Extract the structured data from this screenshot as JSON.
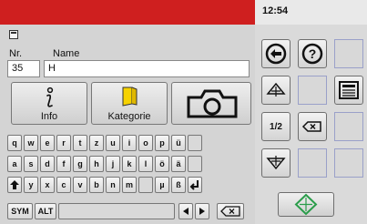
{
  "status": {
    "time": "12:54"
  },
  "form": {
    "nr_label": "Nr.",
    "name_label": "Name",
    "nr_value": "35",
    "name_value": "H"
  },
  "buttons": {
    "info": "Info",
    "kategorie": "Kategorie"
  },
  "keyboard": {
    "row1": [
      "q",
      "w",
      "e",
      "r",
      "t",
      "z",
      "u",
      "i",
      "o",
      "p",
      "ü"
    ],
    "row2": [
      "a",
      "s",
      "d",
      "f",
      "g",
      "h",
      "j",
      "k",
      "l",
      "ö",
      "ä"
    ],
    "row3": [
      "y",
      "x",
      "c",
      "v",
      "b",
      "n",
      "m",
      "µ",
      "ß"
    ],
    "sym": "SYM",
    "alt": "ALT"
  },
  "side": {
    "page": "1/2"
  },
  "icons": [
    "form-icon",
    "info-icon",
    "folder-icon",
    "camera-icon",
    "back-arrow-icon",
    "help-icon",
    "up-icon",
    "save-icon",
    "backspace-icon",
    "down-icon",
    "ok-icon",
    "shift-icon",
    "enter-icon",
    "left-arrow-icon",
    "right-arrow-icon"
  ],
  "colors": {
    "header_red": "#cf1f1f",
    "folder_yellow": "#f6d200",
    "ok_green": "#2a9d4a"
  }
}
